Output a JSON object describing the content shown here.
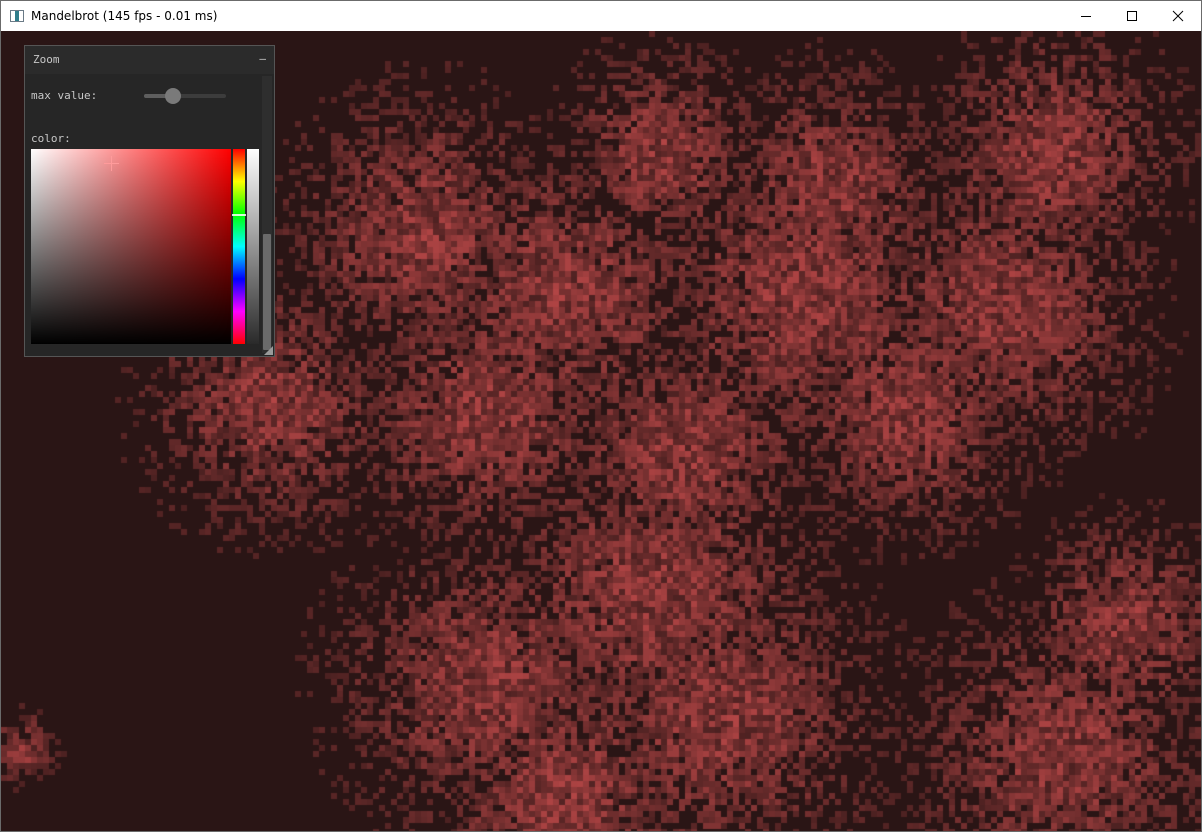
{
  "window": {
    "title": "Mandelbrot (145 fps - 0.01 ms)",
    "icons": {
      "app": "app-icon",
      "minimize": "minimize-icon",
      "maximize": "maximize-icon",
      "close": "close-icon"
    }
  },
  "render": {
    "base_color": "#2a1515",
    "glow_color": "#e05555"
  },
  "zoom_panel": {
    "title": "Zoom",
    "collapse_symbol": "–",
    "max_value_label": "max value:",
    "max_value_fraction": 0.35,
    "color_label": "color:",
    "color": {
      "hue_color": "#ff0000",
      "saturation": 0.4,
      "value": 0.93,
      "hue_fraction": 0.0
    },
    "scrollbar": {
      "thumb_start_fraction": 0.57,
      "thumb_end_fraction": 0.99
    }
  }
}
